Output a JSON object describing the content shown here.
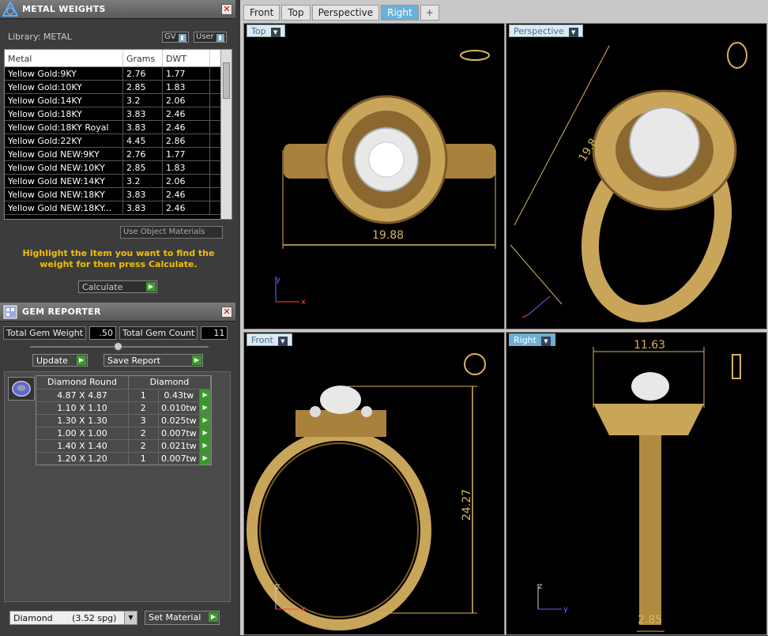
{
  "metal_weights": {
    "title": "METAL WEIGHTS",
    "library_label": "Library: METAL",
    "toggle_gv": "GV",
    "toggle_user": "User",
    "columns": [
      "Metal",
      "Grams",
      "DWT"
    ],
    "rows": [
      [
        "Yellow Gold:9KY",
        "2.76",
        "1.77"
      ],
      [
        "Yellow Gold:10KY",
        "2.85",
        "1.83"
      ],
      [
        "Yellow Gold:14KY",
        "3.2",
        "2.06"
      ],
      [
        "Yellow Gold:18KY",
        "3.83",
        "2.46"
      ],
      [
        "Yellow Gold:18KY Royal",
        "3.83",
        "2.46"
      ],
      [
        "Yellow Gold:22KY",
        "4.45",
        "2.86"
      ],
      [
        "Yellow Gold NEW:9KY",
        "2.76",
        "1.77"
      ],
      [
        "Yellow Gold NEW:10KY",
        "2.85",
        "1.83"
      ],
      [
        "Yellow Gold NEW:14KY",
        "3.2",
        "2.06"
      ],
      [
        "Yellow Gold NEW:18KY",
        "3.83",
        "2.46"
      ],
      [
        "Yellow Gold NEW:18KY...",
        "3.83",
        "2.46"
      ]
    ],
    "use_object_materials": "Use Object Materials",
    "hint": "Highlight the item you want to find the weight for then press Calculate.",
    "calculate": "Calculate"
  },
  "gem_reporter": {
    "title": "GEM REPORTER",
    "total_weight_label": "Total Gem Weight",
    "total_weight": ".50",
    "total_count_label": "Total Gem Count",
    "total_count": "11",
    "update": "Update",
    "save_report": "Save Report",
    "columns": [
      "Diamond Round",
      "Diamond"
    ],
    "rows": [
      [
        "4.87 X 4.87",
        "1",
        "0.43tw"
      ],
      [
        "1.10 X 1.10",
        "2",
        "0.010tw"
      ],
      [
        "1.30 X 1.30",
        "3",
        "0.025tw"
      ],
      [
        "1.00 X 1.00",
        "2",
        "0.007tw"
      ],
      [
        "1.40 X 1.40",
        "2",
        "0.021tw"
      ],
      [
        "1.20 X 1.20",
        "1",
        "0.007tw"
      ]
    ],
    "material_select": "Diamond       (3.52 spg)",
    "set_material": "Set Material"
  },
  "tabs": [
    "Front",
    "Top",
    "Perspective",
    "Right"
  ],
  "viewports": {
    "top": {
      "label": "Top",
      "dim": "19.88"
    },
    "perspective": {
      "label": "Perspective",
      "dim": "19.8"
    },
    "front": {
      "label": "Front",
      "dim": "24.27"
    },
    "right": {
      "label": "Right",
      "dim_top": "11.63",
      "dim_bottom": "2.85"
    }
  },
  "colors": {
    "gold": "#d8b460",
    "accent": "#6ab0d8",
    "go": "#3a9a2a"
  }
}
